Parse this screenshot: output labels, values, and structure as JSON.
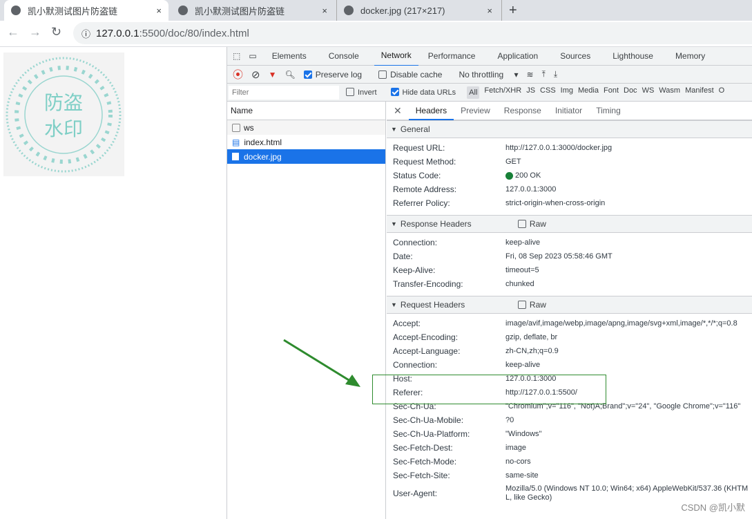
{
  "browser": {
    "tabs": [
      {
        "title": "凯小默测试图片防盗链",
        "active": true
      },
      {
        "title": "凯小默测试图片防盗链",
        "active": false
      },
      {
        "title": "docker.jpg (217×217)",
        "active": false
      }
    ],
    "new_tab": "+",
    "close": "×",
    "url_host": "127.0.0.1",
    "url_path": ":5500/doc/80/index.html"
  },
  "page": {
    "watermark_text": [
      "防盗",
      "水印"
    ]
  },
  "devtools": {
    "tabs": [
      "Elements",
      "Console",
      "Network",
      "Performance",
      "Application",
      "Sources",
      "Lighthouse",
      "Memory"
    ],
    "active_tab": "Network",
    "toolbar": {
      "preserve_log": "Preserve log",
      "preserve_log_checked": true,
      "disable_cache": "Disable cache",
      "disable_cache_checked": false,
      "throttling": "No throttling"
    },
    "filter": {
      "placeholder": "Filter",
      "invert": "Invert",
      "hide_data_urls": "Hide data URLs",
      "types": [
        "All",
        "Fetch/XHR",
        "JS",
        "CSS",
        "Img",
        "Media",
        "Font",
        "Doc",
        "WS",
        "Wasm",
        "Manifest",
        "O"
      ]
    },
    "name_header": "Name",
    "requests": [
      {
        "name": "ws",
        "selected": false
      },
      {
        "name": "index.html",
        "selected": false
      },
      {
        "name": "docker.jpg",
        "selected": true
      }
    ],
    "detail_tabs": [
      "Headers",
      "Preview",
      "Response",
      "Initiator",
      "Timing"
    ],
    "general": {
      "title": "General",
      "rows": [
        [
          "Request URL:",
          "http://127.0.0.1:3000/docker.jpg"
        ],
        [
          "Request Method:",
          "GET"
        ],
        [
          "Status Code:",
          "200 OK"
        ],
        [
          "Remote Address:",
          "127.0.0.1:3000"
        ],
        [
          "Referrer Policy:",
          "strict-origin-when-cross-origin"
        ]
      ]
    },
    "status_color": "#188038",
    "response_headers": {
      "title": "Response Headers",
      "raw": "Raw",
      "rows": [
        [
          "Connection:",
          "keep-alive"
        ],
        [
          "Date:",
          "Fri, 08 Sep 2023 05:58:46 GMT"
        ],
        [
          "Keep-Alive:",
          "timeout=5"
        ],
        [
          "Transfer-Encoding:",
          "chunked"
        ]
      ]
    },
    "request_headers": {
      "title": "Request Headers",
      "raw": "Raw",
      "rows": [
        [
          "Accept:",
          "image/avif,image/webp,image/apng,image/svg+xml,image/*,*/*;q=0.8"
        ],
        [
          "Accept-Encoding:",
          "gzip, deflate, br"
        ],
        [
          "Accept-Language:",
          "zh-CN,zh;q=0.9"
        ],
        [
          "Connection:",
          "keep-alive"
        ],
        [
          "Host:",
          "127.0.0.1:3000"
        ],
        [
          "Referer:",
          "http://127.0.0.1:5500/"
        ],
        [
          "Sec-Ch-Ua:",
          "\"Chromium\";v=\"116\", \"Not)A;Brand\";v=\"24\", \"Google Chrome\";v=\"116\""
        ],
        [
          "Sec-Ch-Ua-Mobile:",
          "?0"
        ],
        [
          "Sec-Ch-Ua-Platform:",
          "\"Windows\""
        ],
        [
          "Sec-Fetch-Dest:",
          "image"
        ],
        [
          "Sec-Fetch-Mode:",
          "no-cors"
        ],
        [
          "Sec-Fetch-Site:",
          "same-site"
        ],
        [
          "User-Agent:",
          "Mozilla/5.0 (Windows NT 10.0; Win64; x64) AppleWebKit/537.36 (KHTML, like Gecko)"
        ]
      ]
    }
  },
  "annotation_color": "#2e8b2e",
  "footer": "CSDN @凯小默"
}
